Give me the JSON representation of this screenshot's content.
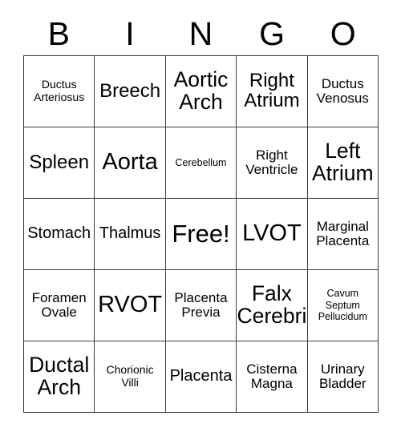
{
  "card": {
    "title": "BINGO",
    "header_letters": [
      "B",
      "I",
      "N",
      "G",
      "O"
    ],
    "border_color": "#3a3a3a",
    "background_color": "#ffffff",
    "text_color": "#000000",
    "columns": 5,
    "rows": 5,
    "free_space": "Free!",
    "free_space_position": "center",
    "cells": [
      [
        {
          "label": "Ductus\nArteriosus",
          "size": "sm"
        },
        {
          "label": "Breech",
          "size": "xl"
        },
        {
          "label": "Aortic\nArch",
          "size": "2xl"
        },
        {
          "label": "Right\nAtrium",
          "size": "xl"
        },
        {
          "label": "Ductus\nVenosus",
          "size": "md"
        }
      ],
      [
        {
          "label": "Spleen",
          "size": "xl"
        },
        {
          "label": "Aorta",
          "size": "3xl"
        },
        {
          "label": "Cerebellum",
          "size": "xs"
        },
        {
          "label": "Right\nVentricle",
          "size": "md"
        },
        {
          "label": "Left\nAtrium",
          "size": "2xl"
        }
      ],
      [
        {
          "label": "Stomach",
          "size": "lg"
        },
        {
          "label": "Thalmus",
          "size": "lg"
        },
        {
          "label": "Free!",
          "size": "4xl"
        },
        {
          "label": "LVOT",
          "size": "3xl"
        },
        {
          "label": "Marginal\nPlacenta",
          "size": "md"
        }
      ],
      [
        {
          "label": "Foramen\nOvale",
          "size": "md"
        },
        {
          "label": "RVOT",
          "size": "3xl"
        },
        {
          "label": "Placenta\nPrevia",
          "size": "md"
        },
        {
          "label": "Falx\nCerebri",
          "size": "2xl"
        },
        {
          "label": "Cavum\nSeptum\nPellucidum",
          "size": "xs"
        }
      ],
      [
        {
          "label": "Ductal\nArch",
          "size": "2xl"
        },
        {
          "label": "Chorionic\nVilli",
          "size": "sm"
        },
        {
          "label": "Placenta",
          "size": "lg"
        },
        {
          "label": "Cisterna\nMagna",
          "size": "md"
        },
        {
          "label": "Urinary\nBladder",
          "size": "md"
        }
      ]
    ]
  }
}
